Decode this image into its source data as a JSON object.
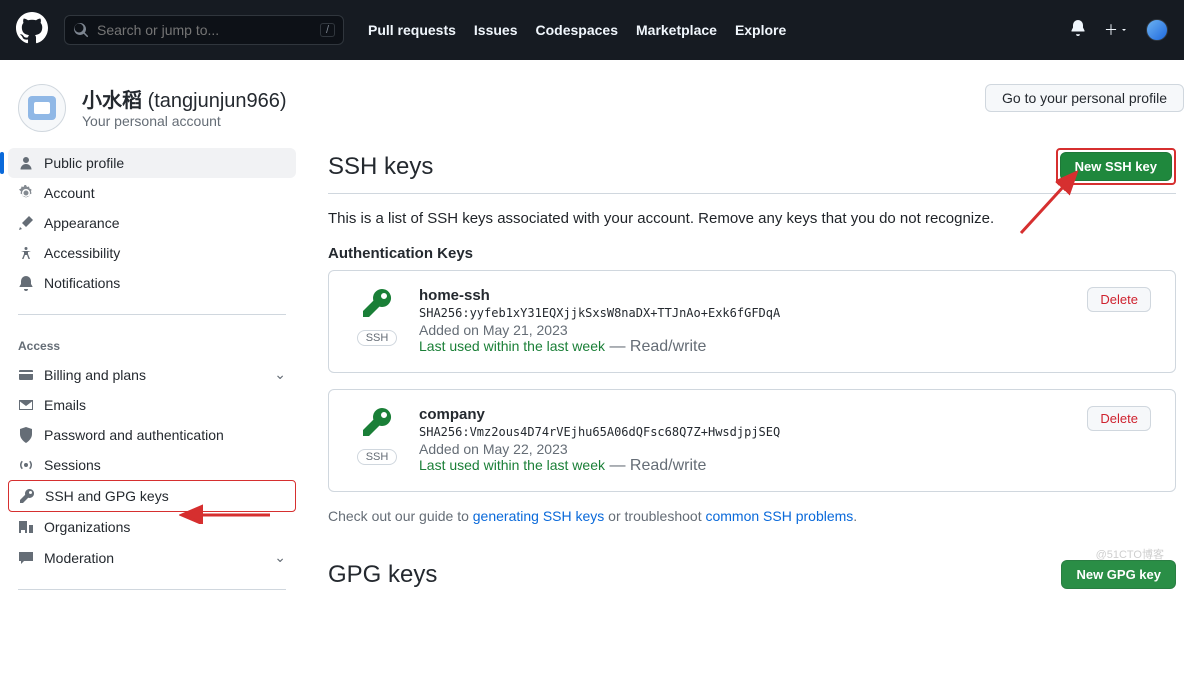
{
  "topbar": {
    "search_placeholder": "Search or jump to...",
    "nav": [
      "Pull requests",
      "Issues",
      "Codespaces",
      "Marketplace",
      "Explore"
    ]
  },
  "user": {
    "display_name": "小水稻",
    "handle": "(tangjunjun966)",
    "subtitle": "Your personal account",
    "goto_profile": "Go to your personal profile"
  },
  "sidebar": {
    "top": [
      {
        "label": "Public profile",
        "icon": "person"
      },
      {
        "label": "Account",
        "icon": "gear"
      },
      {
        "label": "Appearance",
        "icon": "brush"
      },
      {
        "label": "Accessibility",
        "icon": "accessibility"
      },
      {
        "label": "Notifications",
        "icon": "bell"
      }
    ],
    "access_head": "Access",
    "access": [
      {
        "label": "Billing and plans",
        "icon": "card",
        "chev": true
      },
      {
        "label": "Emails",
        "icon": "mail"
      },
      {
        "label": "Password and authentication",
        "icon": "shield"
      },
      {
        "label": "Sessions",
        "icon": "broadcast"
      },
      {
        "label": "SSH and GPG keys",
        "icon": "key"
      },
      {
        "label": "Organizations",
        "icon": "org"
      },
      {
        "label": "Moderation",
        "icon": "comment",
        "chev": true
      }
    ]
  },
  "page": {
    "ssh_title": "SSH keys",
    "new_ssh": "New SSH key",
    "description": "This is a list of SSH keys associated with your account. Remove any keys that you do not recognize.",
    "auth_head": "Authentication Keys",
    "ssh_label": "SSH",
    "delete": "Delete",
    "keys": [
      {
        "name": "home-ssh",
        "fp": "SHA256:yyfeb1xY31EQXjjkSxsW8naDX+TTJnAo+Exk6fGFDqA",
        "added": "Added on May 21, 2023",
        "last": "Last used within the last week",
        "rw": " — Read/write"
      },
      {
        "name": "company",
        "fp": "SHA256:Vmz2ous4D74rVEjhu65A06dQFsc68Q7Z+HwsdjpjSEQ",
        "added": "Added on May 22, 2023",
        "last": "Last used within the last week",
        "rw": " — Read/write"
      }
    ],
    "guide_prefix": "Check out our guide to ",
    "guide_link1": "generating SSH keys",
    "guide_mid": " or troubleshoot ",
    "guide_link2": "common SSH problems",
    "guide_suffix": ".",
    "gpg_title": "GPG keys",
    "new_gpg": "New GPG key"
  },
  "watermark": "@51CTO博客"
}
